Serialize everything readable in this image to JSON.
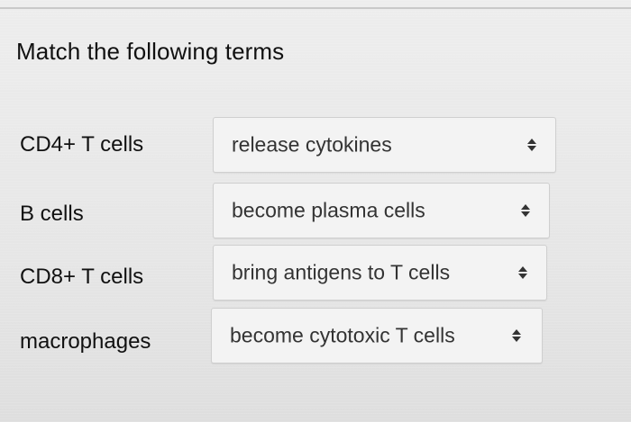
{
  "title": "Match the following terms",
  "rows": [
    {
      "term": "CD4+ T cells",
      "selected": "release cytokines"
    },
    {
      "term": "B cells",
      "selected": "become plasma cells"
    },
    {
      "term": "CD8+ T cells",
      "selected": "bring antigens to T cells"
    },
    {
      "term": "macrophages",
      "selected": "become cytotoxic T cells"
    }
  ],
  "select_icon": "updown-arrows-icon"
}
